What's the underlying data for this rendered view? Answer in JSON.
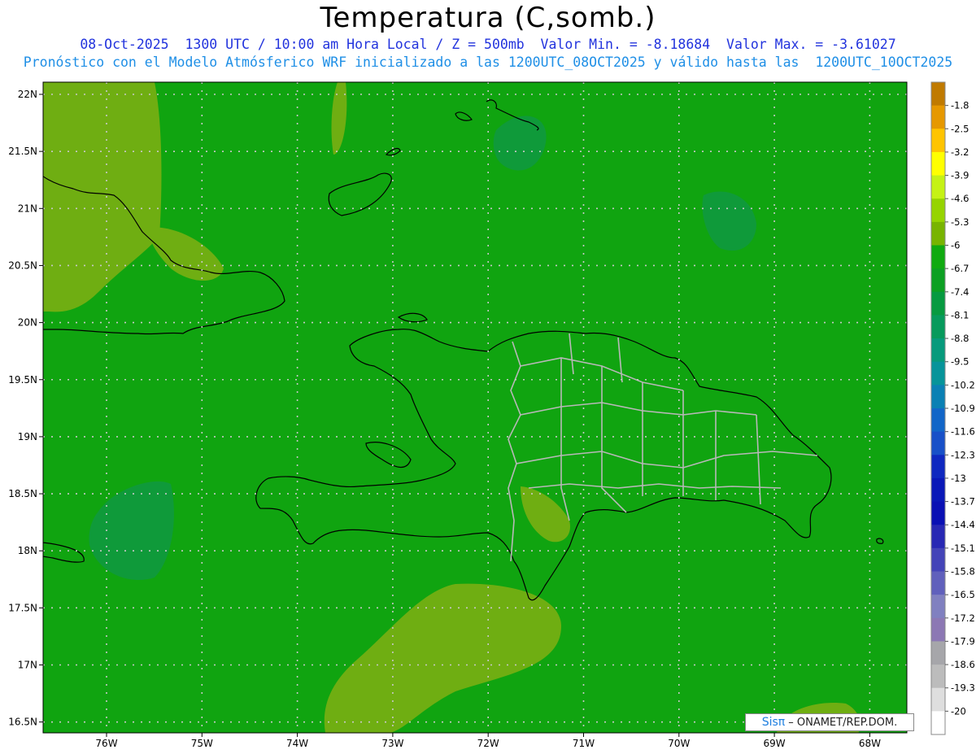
{
  "title": "Temperatura (C,somb.)",
  "subtitle_line1": "08-Oct-2025  1300 UTC / 10:00 am Hora Local / Z = 500mb  Valor Min. = -8.18684  Valor Max. = -3.61027",
  "subtitle_line2": "Pronóstico con el Modelo Atmósferico WRF inicializado a las 1200UTC_08OCT2025 y válido hasta las  1200UTC_10OCT2025",
  "credit": {
    "logo": "Sisπ",
    "text": "– ONAMET/REP.DOM."
  },
  "chart_data": {
    "type": "heatmap",
    "variable": "Temperatura (C,somb.)",
    "level": "500mb",
    "min_value": -8.18684,
    "max_value": -3.61027,
    "lat_ticks": [
      "22N",
      "21.5N",
      "21N",
      "20.5N",
      "20N",
      "19.5N",
      "19N",
      "18.5N",
      "18N",
      "17.5N",
      "17N",
      "16.5N"
    ],
    "lat_values": [
      22,
      21.5,
      21,
      20.5,
      20,
      19.5,
      19,
      18.5,
      18,
      17.5,
      17,
      16.5
    ],
    "lon_ticks": [
      "76W",
      "75W",
      "74W",
      "73W",
      "72W",
      "71W",
      "70W",
      "69W",
      "68W"
    ],
    "lon_values": [
      -76,
      -75,
      -74,
      -73,
      -72,
      -71,
      -70,
      -69,
      -68
    ],
    "colorbar": {
      "labels": [
        "-1.8",
        "-2.5",
        "-3.2",
        "-3.9",
        "-4.6",
        "-5.3",
        "-6",
        "-6.7",
        "-7.4",
        "-8.1",
        "-8.8",
        "-9.5",
        "-10.2",
        "-10.9",
        "-11.6",
        "-12.3",
        "-13",
        "-13.7",
        "-14.4",
        "-15.1",
        "-15.8",
        "-16.5",
        "-17.2",
        "-17.9",
        "-18.6",
        "-19.3",
        "-20"
      ],
      "colors": [
        "#c07a00",
        "#e69800",
        "#ffc400",
        "#ffff00",
        "#c5f215",
        "#96d400",
        "#78b400",
        "#10aa10",
        "#0ca022",
        "#069a40",
        "#069a5c",
        "#069a7c",
        "#06949a",
        "#0a80b4",
        "#1266c8",
        "#1850c8",
        "#0f28c0",
        "#0a18b8",
        "#0a10b4",
        "#2828b4",
        "#4444b8",
        "#6060bc",
        "#8080c0",
        "#8c78b4",
        "#a6a6aa",
        "#bcbcbc",
        "#dedede",
        "#ffffff"
      ]
    },
    "field_colors": {
      "background": "#10a410",
      "warm_patch": "#6fae12",
      "cool_patch": "#0f9a3a"
    }
  }
}
